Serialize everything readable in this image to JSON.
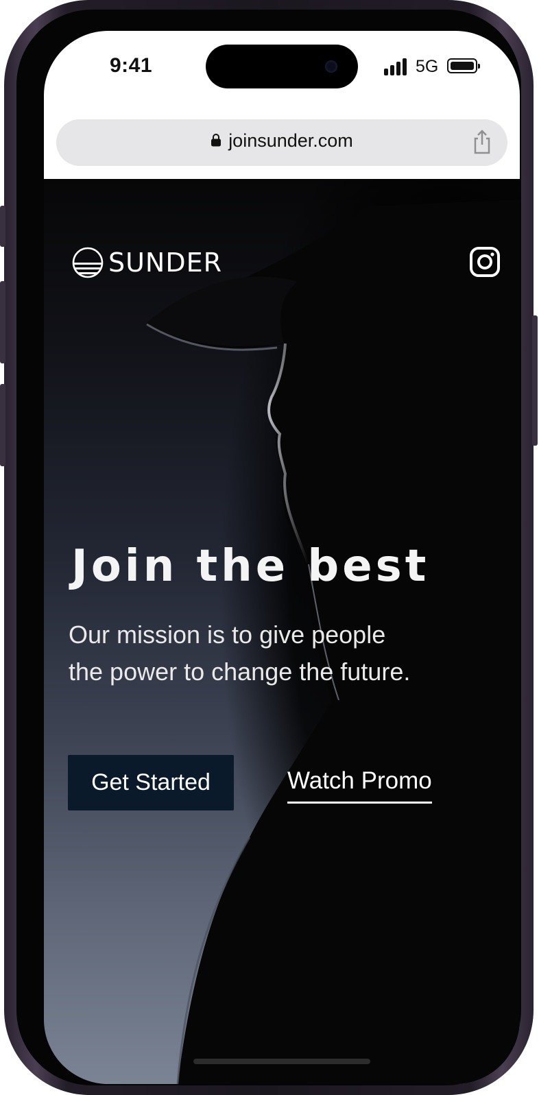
{
  "status_bar": {
    "time": "9:41",
    "network": "5G"
  },
  "browser": {
    "url": "joinsunder.com"
  },
  "site": {
    "brand": "SUNDER",
    "logo_icon": "sun-horizon-icon",
    "social_icon": "instagram-icon"
  },
  "hero": {
    "headline": "Join the best",
    "subtitle_line1": "Our mission is to give people",
    "subtitle_line2": "the power to change the future.",
    "primary_cta": "Get Started",
    "secondary_cta": "Watch Promo"
  },
  "colors": {
    "primary_button_bg": "#0b1a2a",
    "text": "#ffffff"
  }
}
